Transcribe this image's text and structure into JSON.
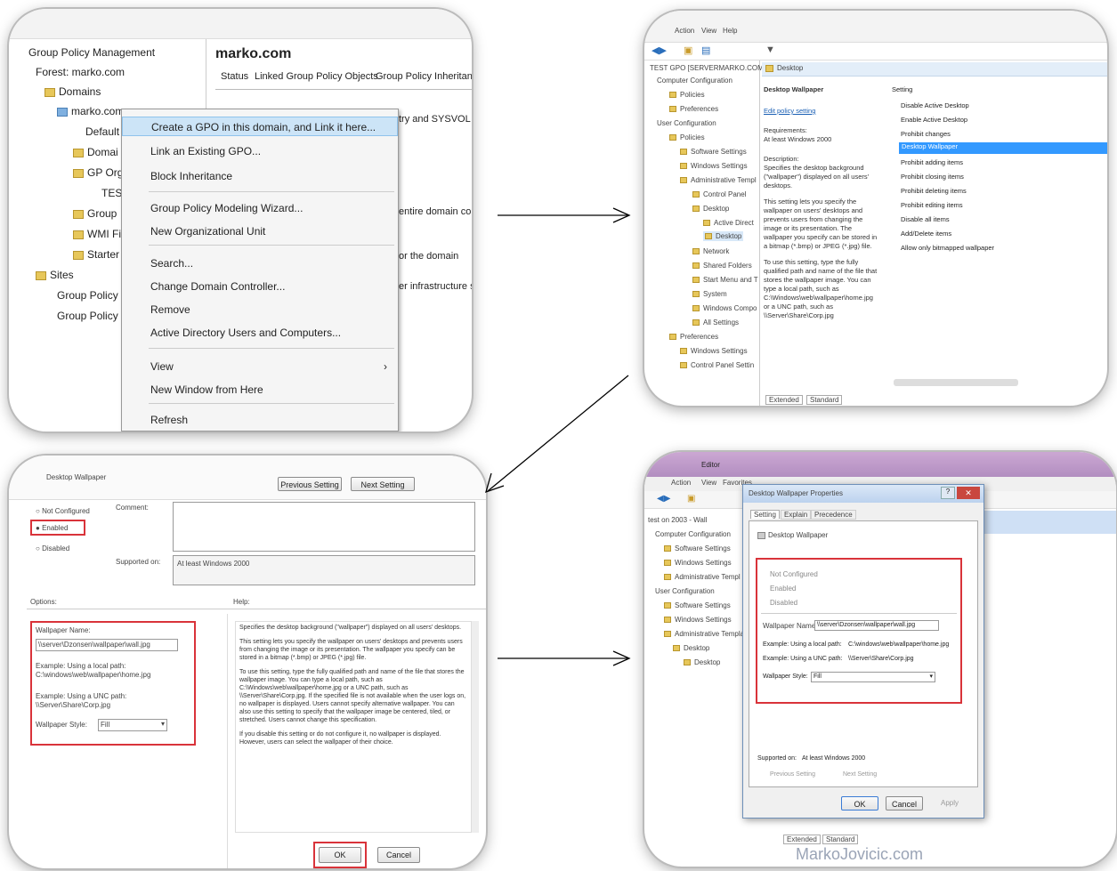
{
  "p1": {
    "tree_title": "Group Policy Management",
    "tree": [
      "Forest: marko.com",
      "Domains",
      "marko.com",
      "Default",
      "Domai",
      "GP Org",
      "TES",
      "Group",
      "WMI Fi",
      "Starter",
      "Sites",
      "Group Policy M",
      "Group Policy R"
    ],
    "header": "marko.com",
    "tabs": [
      "Status",
      "Linked Group Policy Objects",
      "Group Policy Inheritance"
    ],
    "right_text": [
      "try and SYSVOL re",
      "entire domain con",
      "or the domain",
      "er infrastructure st"
    ],
    "menu": [
      "Create a GPO in this domain, and Link it here...",
      "Link an Existing GPO...",
      "Block Inheritance",
      "Group Policy Modeling Wizard...",
      "New Organizational Unit",
      "Search...",
      "Change Domain Controller...",
      "Remove",
      "Active Directory Users and Computers...",
      "View",
      "New Window from Here",
      "Refresh"
    ]
  },
  "p2": {
    "menubar": [
      "Action",
      "View",
      "Help"
    ],
    "tree": [
      "TEST GPO [SERVERMARKO.COM]",
      "Computer Configuration",
      "Policies",
      "Preferences",
      "User Configuration",
      "Policies",
      "Software Settings",
      "Windows Settings",
      "Administrative Templ",
      "Control Panel",
      "Desktop",
      "Active Direct",
      "Desktop",
      "Network",
      "Shared Folders",
      "Start Menu and T",
      "System",
      "Windows Compo",
      "All Settings",
      "Preferences",
      "Windows Settings",
      "Control Panel Settin"
    ],
    "folder_header": "Desktop",
    "title": "Desktop Wallpaper",
    "edit_link": "Edit policy setting",
    "requirements": "Requirements:",
    "requirements_value": "At least Windows 2000",
    "description_label": "Description:",
    "description": "Specifies the desktop background (\"wallpaper\") displayed on all users' desktops.",
    "desc2": "This setting lets you specify the wallpaper on users' desktops and prevents users from changing the image or its presentation. The wallpaper you specify can be stored in a bitmap (*.bmp) or JPEG (*.jpg) file.",
    "desc3": "To use this setting, type the fully qualified path and name of the file that stores the wallpaper image. You can type a local path, such as C:\\Windows\\web\\wallpaper\\home.jpg or a UNC path, such as \\\\Server\\Share\\Corp.jpg",
    "setting_header": "Setting",
    "settings": [
      "Disable Active Desktop",
      "Enable Active Desktop",
      "Prohibit changes",
      "Desktop Wallpaper",
      "Prohibit adding items",
      "Prohibit closing items",
      "Prohibit deleting items",
      "Prohibit editing items",
      "Disable all items",
      "Add/Delete items",
      "Allow only bitmapped wallpaper"
    ],
    "bottom_tabs": [
      "Extended",
      "Standard"
    ]
  },
  "p3": {
    "title": "Desktop Wallpaper",
    "prev_btn": "Previous Setting",
    "next_btn": "Next Setting",
    "radio": [
      "Not Configured",
      "Enabled",
      "Disabled"
    ],
    "comment_label": "Comment:",
    "supported_label": "Supported on:",
    "supported_value": "At least Windows 2000",
    "options_label": "Options:",
    "help_label": "Help:",
    "wallpaper_name_label": "Wallpaper Name:",
    "wallpaper_name_value": "\\\\server\\Dzonsen\\wallpaper\\wall.jpg",
    "example_local": "Example: Using a local path:",
    "example_local_value": "C:\\windows\\web\\wallpaper\\home.jpg",
    "example_unc": "Example: Using a UNC path:",
    "example_unc_value": "\\\\Server\\Share\\Corp.jpg",
    "wallpaper_style_label": "Wallpaper Style:",
    "wallpaper_style_value": "Fill",
    "help_p1": "Specifies the desktop background (\"wallpaper\") displayed on all users' desktops.",
    "help_p2": "This setting lets you specify the wallpaper on users' desktops and prevents users from changing the image or its presentation. The wallpaper you specify can be stored in a bitmap (*.bmp) or JPEG (*.jpg) file.",
    "help_p3": "To use this setting, type the fully qualified path and name of the file that stores the wallpaper image. You can type a local path, such as C:\\Windows\\web\\wallpaper\\home.jpg or a UNC path, such as \\\\Server\\Share\\Corp.jpg. If the specified file is not available when the user logs on, no wallpaper is displayed. Users cannot specify alternative wallpaper. You can also use this setting to specify that the wallpaper image be centered, tiled, or stretched. Users cannot change this specification.",
    "help_p4": "If you disable this setting or do not configure it, no wallpaper is displayed. However, users can select the wallpaper of their choice.",
    "ok": "OK",
    "cancel": "Cancel"
  },
  "p4": {
    "title_bar": "Editor",
    "menubar": [
      "Action",
      "View",
      "Favorites",
      "Window",
      "Help"
    ],
    "tree": [
      "test on 2003 - Wall",
      "Computer Configuration",
      "Software Settings",
      "Windows Settings",
      "Administrative Templ",
      "User Configuration",
      "Software Settings",
      "Windows Settings",
      "Administrative Templa",
      "Desktop",
      "Desktop"
    ],
    "dialog_title": "Desktop Wallpaper Properties",
    "tabs": [
      "Setting",
      "Explain",
      "Precedence"
    ],
    "setting_name": "Desktop Wallpaper",
    "radio": [
      "Not Configured",
      "Enabled",
      "Disabled"
    ],
    "wallpaper_name_label": "Wallpaper Name:",
    "wallpaper_name_value": "\\\\server\\Dzonsen\\wallpaper\\wall.jpg",
    "example_local": "Example: Using a local path:",
    "example_local_value": "C:\\windows\\web\\wallpaper\\home.jpg",
    "example_unc": "Example: Using a UNC path:",
    "example_unc_value": "\\\\Server\\Share\\Corp.jpg",
    "wallpaper_style_label": "Wallpaper Style:",
    "wallpaper_style_value": "Fill",
    "supported_label": "Supported on:",
    "supported_value": "At least Windows 2000",
    "prev_btn": "Previous Setting",
    "next_btn": "Next Setting",
    "ok": "OK",
    "cancel": "Cancel",
    "apply": "Apply",
    "bottom_tabs": [
      "Extended",
      "Standard"
    ],
    "watermark": "MarkoJovicic.com"
  },
  "colors": {
    "accent": "#3399ff",
    "highlight_red": "#d9333a",
    "folder": "#e7c75a",
    "dialog_blue": "#cfe0f5"
  }
}
